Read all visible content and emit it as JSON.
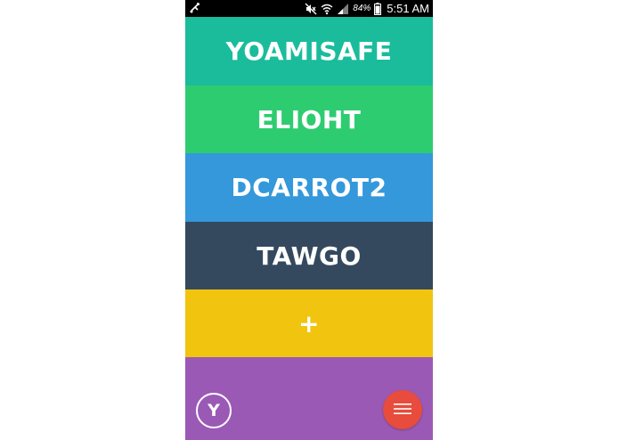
{
  "statusbar": {
    "battery_percent": "84%",
    "time": "5:51 AM",
    "icons": [
      "usb-debug-icon",
      "mute-icon",
      "wifi-icon",
      "signal-icon",
      "battery-icon"
    ]
  },
  "accounts": [
    {
      "label": "YOAMISAFE",
      "color": "#1abc9c"
    },
    {
      "label": "ELIOHT",
      "color": "#2ecc71"
    },
    {
      "label": "DCARROT2",
      "color": "#3498db"
    },
    {
      "label": "TAWGO",
      "color": "#34495e"
    }
  ],
  "add_tile": {
    "label": "+",
    "color": "#f1c40f"
  },
  "bottom_bar": {
    "color": "#9b59b6",
    "y_button_label": "Y",
    "menu_button_color": "#e74c3c",
    "menu_icon": "hamburger-menu-icon"
  }
}
